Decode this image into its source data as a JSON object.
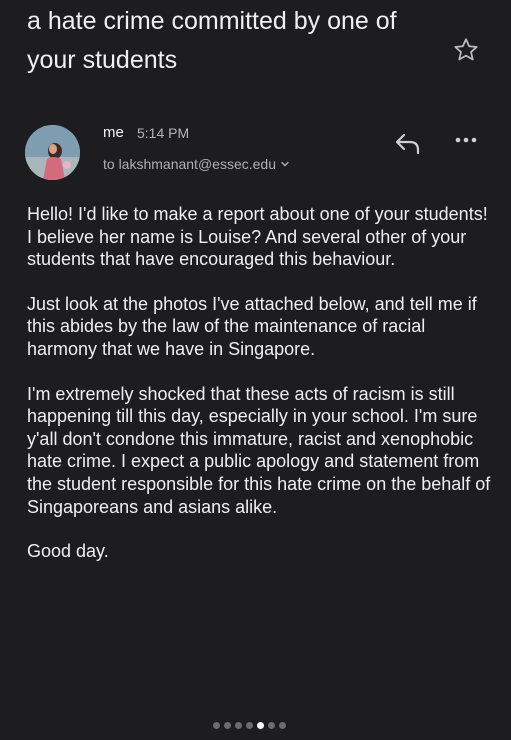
{
  "email": {
    "subject": "a hate crime committed by one of your students",
    "sender": "me",
    "time": "5:14 PM",
    "recipient": "to lakshmanant@essec.edu",
    "paragraphs": [
      "Hello! I'd like to make a report about one of your students! I believe her name is Louise? And several other of your students that have encouraged this behaviour.",
      "Just look at the photos I've attached below, and tell me if this abides by the law of the maintenance of racial harmony that we have in Singapore.",
      "I'm extremely shocked that these acts of racism is still happening till this day, especially in your school. I'm sure y'all don't condone this immature, racist and xenophobic hate crime. I expect a public apology and statement from the student responsible for this hate crime on the behalf of Singaporeans and asians alike.",
      "Good day."
    ]
  },
  "icons": {
    "star": "star-icon",
    "reply": "reply-icon",
    "more": "more-icon",
    "recipient_expand": "chevron-down-icon"
  },
  "pager": {
    "total": 7,
    "active_index": 4
  },
  "colors": {
    "background": "#1d1d1f",
    "text": "#efefef",
    "secondary_text": "#b0b0b0"
  }
}
